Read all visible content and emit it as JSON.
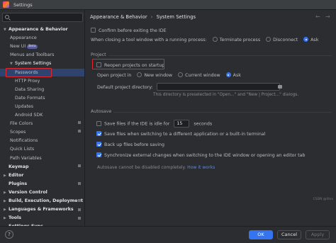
{
  "window": {
    "title": "Settings"
  },
  "sidebar": {
    "search_placeholder": "",
    "items": [
      {
        "label": "Appearance & Behavior",
        "level": 0,
        "expanded": true
      },
      {
        "label": "Appearance",
        "level": 1
      },
      {
        "label": "New UI",
        "level": 1,
        "badge": "Beta"
      },
      {
        "label": "Menus and Toolbars",
        "level": 1
      },
      {
        "label": "System Settings",
        "level": 1,
        "expanded": true,
        "selected": true
      },
      {
        "label": "Passwords",
        "level": 2
      },
      {
        "label": "HTTP Proxy",
        "level": 2
      },
      {
        "label": "Data Sharing",
        "level": 2
      },
      {
        "label": "Date Formats",
        "level": 2
      },
      {
        "label": "Updates",
        "level": 2
      },
      {
        "label": "Android SDK",
        "level": 2
      },
      {
        "label": "File Colors",
        "level": 1
      },
      {
        "label": "Scopes",
        "level": 1
      },
      {
        "label": "Notifications",
        "level": 1
      },
      {
        "label": "Quick Lists",
        "level": 1
      },
      {
        "label": "Path Variables",
        "level": 1
      },
      {
        "label": "Keymap",
        "level": 0
      },
      {
        "label": "Editor",
        "level": 0,
        "expandable": true
      },
      {
        "label": "Plugins",
        "level": 0
      },
      {
        "label": "Version Control",
        "level": 0,
        "expandable": true
      },
      {
        "label": "Build, Execution, Deployment",
        "level": 0,
        "expandable": true
      },
      {
        "label": "Languages & Frameworks",
        "level": 0,
        "expandable": true
      },
      {
        "label": "Tools",
        "level": 0,
        "expandable": true
      },
      {
        "label": "Settings Sync",
        "level": 0
      }
    ]
  },
  "main": {
    "breadcrumb": {
      "parent": "Appearance & Behavior",
      "separator": "›",
      "current": "System Settings"
    },
    "confirm_exit": {
      "label": "Confirm before exiting the IDE",
      "checked": false
    },
    "close_tool_window": {
      "label": "When closing a tool window with a running process:",
      "options": [
        "Terminate process",
        "Disconnect",
        "Ask"
      ],
      "selected": "Ask"
    },
    "project": {
      "title": "Project",
      "reopen": {
        "label": "Reopen projects on startup",
        "checked": false
      },
      "open_project_in": {
        "label": "Open project in",
        "options": [
          "New window",
          "Current window",
          "Ask"
        ],
        "selected": "Ask"
      },
      "default_dir": {
        "label": "Default project directory:",
        "value": "",
        "hint": "This directory is preselected in \"Open...\" and \"New | Project...\" dialogs."
      }
    },
    "autosave": {
      "title": "Autosave",
      "idle": {
        "prefix": "Save files if the IDE is idle for",
        "value": "15",
        "suffix": "seconds",
        "checked": false
      },
      "frame_switch": {
        "label": "Save files when switching to a different application or a built-in terminal",
        "checked": true
      },
      "backup": {
        "label": "Back up files before saving",
        "checked": true
      },
      "sync": {
        "label": "Synchronize external changes when switching to the IDE window or opening an editor tab",
        "checked": true
      },
      "note": "Autosave cannot be disabled completely.",
      "note_link": "How it works"
    }
  },
  "footer": {
    "help": "?",
    "ok": "OK",
    "cancel": "Cancel",
    "apply": "Apply"
  },
  "watermark": "CSDN @itlxx",
  "colors": {
    "accent": "#3574f0",
    "selection": "#2e436e",
    "highlight_box": "#e0262f",
    "background": "#2b2d30"
  }
}
